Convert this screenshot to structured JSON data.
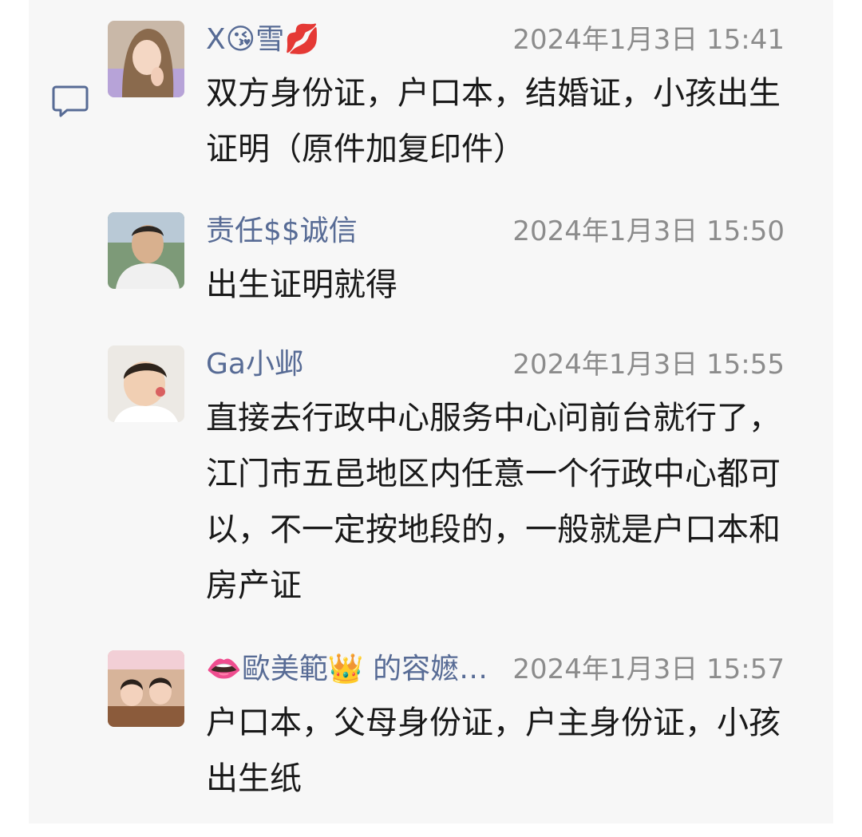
{
  "comments": [
    {
      "sender": "X😘雪💋",
      "time": "2024年1月3日 15:41",
      "text": "双方身份证，户口本，结婚证，小孩出生证明（原件加复印件）",
      "avatar_icon": "user-avatar-icon"
    },
    {
      "sender": "责任$$诚信",
      "time": "2024年1月3日 15:50",
      "text": "出生证明就得",
      "avatar_icon": "user-avatar-icon"
    },
    {
      "sender": "Ga小邺",
      "time": "2024年1月3日 15:55",
      "text": "直接去行政中心服务中心问前台就行了，江门市五邑地区内任意一个行政中心都可以，不一定按地段的，一般就是户口本和房产证",
      "avatar_icon": "user-avatar-icon"
    },
    {
      "sender": "👄歐美範👑 的容嬷…",
      "time": "2024年1月3日 15:57",
      "text": "户口本，父母身份证，户主身份证，小孩出生纸",
      "avatar_icon": "user-avatar-icon"
    }
  ],
  "colors": {
    "name": "#576b95",
    "time": "#8c8c8c",
    "text": "#191919",
    "panel": "#f7f7f7"
  },
  "icons": {
    "comment": "comment-icon"
  }
}
